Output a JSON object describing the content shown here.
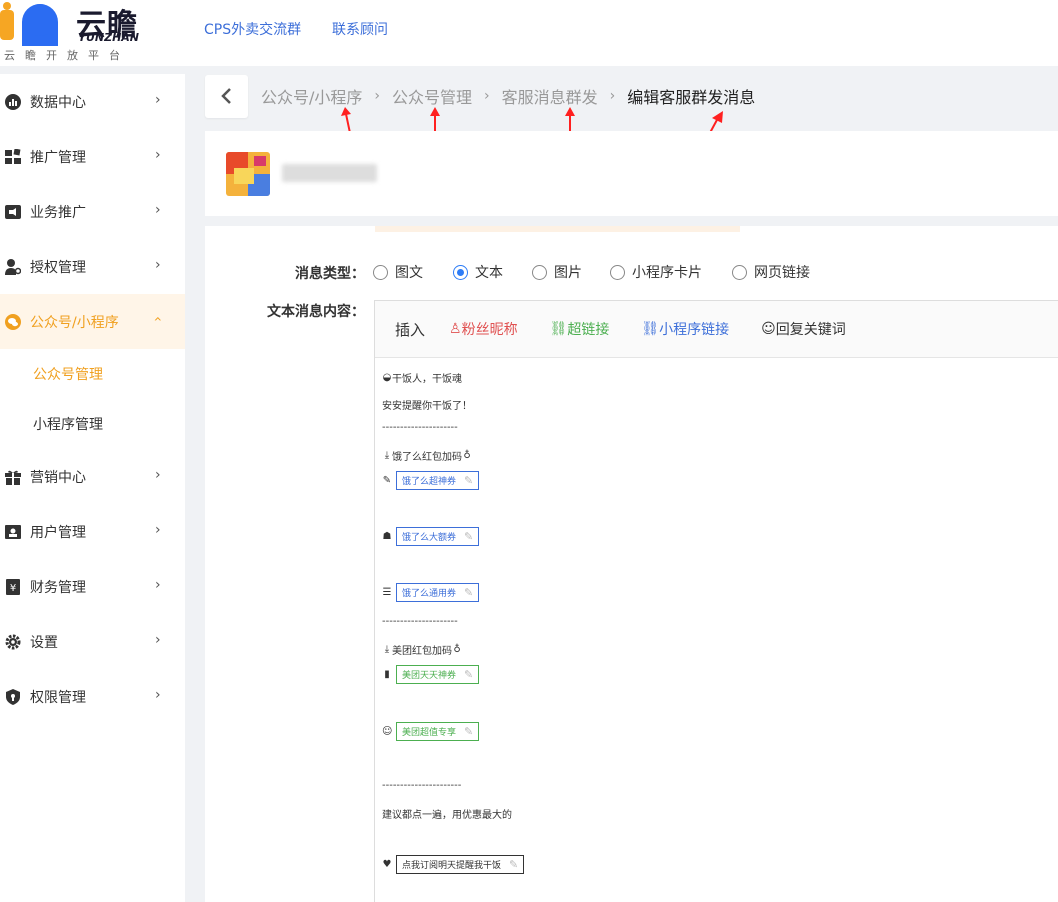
{
  "header": {
    "logo_text": "云瞻",
    "logo_sub": "YUNZHAN",
    "tagline": "云瞻开放平台",
    "links": [
      "CPS外卖交流群",
      "联系顾问"
    ]
  },
  "sidebar": {
    "items": [
      {
        "label": "数据中心",
        "icon": "bar-chart-icon"
      },
      {
        "label": "推广管理",
        "icon": "grid-icon"
      },
      {
        "label": "业务推广",
        "icon": "megaphone-icon"
      },
      {
        "label": "授权管理",
        "icon": "user-key-icon"
      },
      {
        "label": "公众号/小程序",
        "icon": "wechat-icon",
        "active": true
      },
      {
        "label": "营销中心",
        "icon": "gift-icon"
      },
      {
        "label": "用户管理",
        "icon": "id-card-icon"
      },
      {
        "label": "财务管理",
        "icon": "yuan-icon"
      },
      {
        "label": "设置",
        "icon": "gear-icon"
      },
      {
        "label": "权限管理",
        "icon": "shield-icon"
      }
    ],
    "sub_items": [
      "公众号管理",
      "小程序管理"
    ]
  },
  "breadcrumb": [
    "公众号/小程序",
    "公众号管理",
    "客服消息群发",
    "编辑客服群发消息"
  ],
  "form": {
    "type_label": "消息类型：",
    "types": [
      "图文",
      "文本",
      "图片",
      "小程序卡片",
      "网页链接"
    ],
    "selected_type": "文本",
    "content_label": "文本消息内容："
  },
  "toolbar": {
    "insert": "插入",
    "fan_nickname": "粉丝昵称",
    "hyperlink": "超链接",
    "mini_link": "小程序链接",
    "reply_keyword": "回复关键词"
  },
  "message": {
    "line1": "干饭人，干饭魂",
    "line2": "安安提醒你干饭了！",
    "divider1": "---------------------",
    "ele_title": "饿了么红包加码",
    "chip1": "饿了么超神券",
    "chip2": "饿了么大额券",
    "chip3": "饿了么通用券",
    "divider2": "---------------------",
    "mt_title": "美团红包加码",
    "chip4": "美团天天神券",
    "chip5": "美团超值专享",
    "divider3": "----------------------",
    "line_last": "建议都点一遍，用优惠最大的",
    "chip6": "点我订阅明天提醒我干饭"
  },
  "colors": {
    "accent": "#f0a020",
    "link": "#3d6fd9",
    "radio": "#2d7cf6",
    "arrow": "#ff2020",
    "fan": "#e05050",
    "green": "#4caf50"
  }
}
